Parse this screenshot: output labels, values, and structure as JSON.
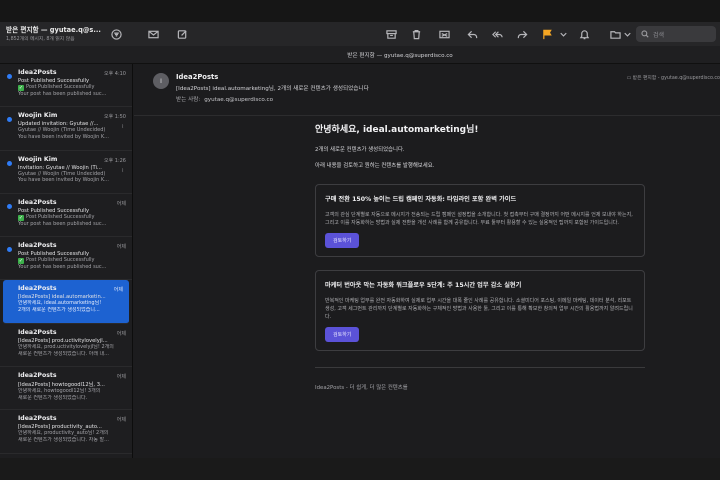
{
  "window": {
    "mailbox_title": "받은 편지함 — gyutae.q@s...",
    "mailbox_subtitle": "1,852개의 메시지, 8개 읽지 않음",
    "subtitle_bar": "받은 편지함 — gyutae.q@superdisco.co"
  },
  "toolbar": {
    "search_placeholder": "검색",
    "icons": [
      "filter-icon",
      "compose-envelope-icon",
      "new-message-icon",
      "archive-icon",
      "trash-icon",
      "junk-icon",
      "reply-icon",
      "reply-all-icon",
      "forward-icon",
      "flag-icon",
      "chevron-down-icon",
      "notify-icon",
      "move-folder-icon",
      "search-icon"
    ],
    "flag_color": "#f5a623"
  },
  "messages": [
    {
      "from": "Idea2Posts",
      "time": "오후 4:10",
      "subject": "Post Published Successfully",
      "preview": [
        "Post Published Successfully",
        "Your post has been published suc..."
      ],
      "unread": true,
      "check": true,
      "attachment": false,
      "selected": false
    },
    {
      "from": "Woojin Kim",
      "time": "오후 1:50",
      "subject": "Updated invitation: Gyutae //...",
      "preview": [
        "Gyutae // Woojin (Time Undecided)",
        "You have been invited by Woojin K..."
      ],
      "unread": true,
      "check": false,
      "attachment": true,
      "selected": false
    },
    {
      "from": "Woojin Kim",
      "time": "오후 1:26",
      "subject": "Invitation: Gyutae // Woojin (Ti...",
      "preview": [
        "Gyutae // Woojin (Time Undecided)",
        "You have been invited by Woojin K..."
      ],
      "unread": true,
      "check": false,
      "attachment": true,
      "selected": false
    },
    {
      "from": "Idea2Posts",
      "time": "어제",
      "subject": "Post Published Successfully",
      "preview": [
        "Post Published Successfully",
        "Your post has been published suc..."
      ],
      "unread": true,
      "check": true,
      "attachment": false,
      "selected": false
    },
    {
      "from": "Idea2Posts",
      "time": "어제",
      "subject": "Post Published Successfully",
      "preview": [
        "Post Published Successfully",
        "Your post has been published suc..."
      ],
      "unread": true,
      "check": true,
      "attachment": false,
      "selected": false
    },
    {
      "from": "Idea2Posts",
      "time": "어제",
      "subject": "[Idea2Posts] ideal.automarketin...",
      "preview": [
        "안녕하세요, ideal.automarketing님!",
        "2개의 새로운 컨텐츠가 생성되었습니..."
      ],
      "unread": false,
      "check": false,
      "attachment": false,
      "selected": true
    },
    {
      "from": "Idea2Posts",
      "time": "어제",
      "subject": "[Idea2Posts] prod.uctivitylovelyjl...",
      "preview": [
        "안녕하세요, prod.uctivitylovelyjl님! 2개의",
        "새로운 컨텐츠가 생성되었습니다. 아래 내..."
      ],
      "unread": false,
      "check": false,
      "attachment": false,
      "selected": false
    },
    {
      "from": "Idea2Posts",
      "time": "어제",
      "subject": "[Idea2Posts] howtogoodl12님, 3...",
      "preview": [
        "안녕하세요, howtogoodl12님! 3개의",
        "새로운 컨텐츠가 생성되었습니다."
      ],
      "unread": false,
      "check": false,
      "attachment": false,
      "selected": false
    },
    {
      "from": "Idea2Posts",
      "time": "어제",
      "subject": "[Idea2Posts] productivity_auto...",
      "preview": [
        "안녕하세요, productivity_auto님! 2개의",
        "새로운 컨텐츠가 생성되었습니다. 자동 발..."
      ],
      "unread": false,
      "check": false,
      "attachment": false,
      "selected": false
    }
  ],
  "reader": {
    "avatar_initial": "I",
    "from": "Idea2Posts",
    "subject": "[Idea2Posts] ideal.automarketing님, 2개의 새로운 컨텐츠가 생성되었습니다",
    "to_label": "받는 사람:",
    "to_value": "gyutae.q@superdisco.co",
    "location": "받은 편지함 - gyutae.q@superdisco.co",
    "greeting": "안녕하세요, ideal.automarketing님!",
    "para1": "2개의 새로운 컨텐츠가 생성되었습니다.",
    "para2": "아래 내용을 검토하고 원하는 컨텐츠를 발행해보세요.",
    "cards": [
      {
        "title": "구매 전환 150% 높이는 드립 캠페인 자동화: 타임라인 포함 완벽 가이드",
        "desc": "고객의 관심 단계별로 자동으로 메시지가 전송되는 드립 캠페인 설정법을 소개합니다. 첫 접촉부터 구매 결정까지 어떤 메시지를 언제 보내야 하는지, 그리고 이를 자동화하는 방법과 실제 전환을 개선 사례를 함께 공유합니다. 무료 툴부터 활용할 수 있는 실용적인 팁까지 포함된 가이드입니다.",
        "button": "검토하기"
      },
      {
        "title": "마케터 번아웃 막는 자동화 워크플로우 5단계: 주 15시간 업무 감소 실현기",
        "desc": "반복적인 마케팅 업무를 완전 자동화하여 실제로 업무 시간을 대폭 줄인 사례를 공유합니다. 소셜미디어 포스팅, 이메일 마케팅, 데이터 분석, 리포트 생성, 고객 세그먼트 관리까지 단계별로 자동화하는 구체적인 방법과 사용한 툴, 그리고 이를 통해 확보한 창의적 업무 시간의 활용법까지 알려드립니다.",
        "button": "검토하기"
      }
    ],
    "footer": "Idea2Posts - 더 쉽게, 더 많은 컨텐츠를"
  },
  "colors": {
    "accent": "#1d62d1",
    "unread_dot": "#2f7cf6",
    "button": "#5b52d8"
  }
}
